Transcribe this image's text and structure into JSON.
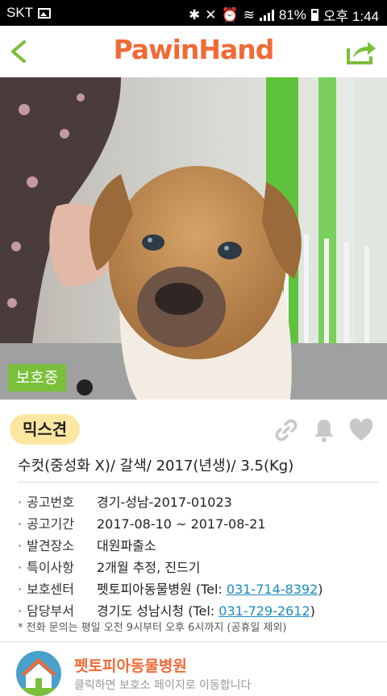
{
  "status_bar": {
    "carrier": "SKT",
    "battery": "81%",
    "time": "오후 1:44"
  },
  "header": {
    "logo_main": "PawinHand"
  },
  "photo": {
    "badge": "보호중"
  },
  "animal": {
    "breed": "믹스견",
    "summary": "수컷(중성화 X)/ 갈색/ 2017(년생)/ 3.5(Kg)"
  },
  "details": [
    {
      "label": "공고번호",
      "value": "경기-성남-2017-01023"
    },
    {
      "label": "공고기간",
      "value": "2017-08-10 ~ 2017-08-21"
    },
    {
      "label": "발견장소",
      "value": "대원파출소"
    },
    {
      "label": "특이사항",
      "value": "2개월 추정, 진드기"
    },
    {
      "label": "보호센터",
      "value": "펫토피아동물병원 (Tel: ",
      "tel": "031-714-8392",
      "suffix": ")"
    },
    {
      "label": "담당부서",
      "value": "경기도 성남시청 (Tel: ",
      "tel": "031-729-2612",
      "suffix": ")"
    }
  ],
  "note": "* 전화 문의는 평일 오전 9시부터 오후 6시까지 (공휴일 제외)",
  "hospital": {
    "name": "펫토피아동물병원",
    "subtitle": "클릭하면 보호소 페이지로 이동합니다"
  },
  "colors": {
    "brand": "#f06a37",
    "green": "#7bbf3b",
    "tel": "#1a8bbf",
    "breed_bg": "#fbe7a1"
  }
}
